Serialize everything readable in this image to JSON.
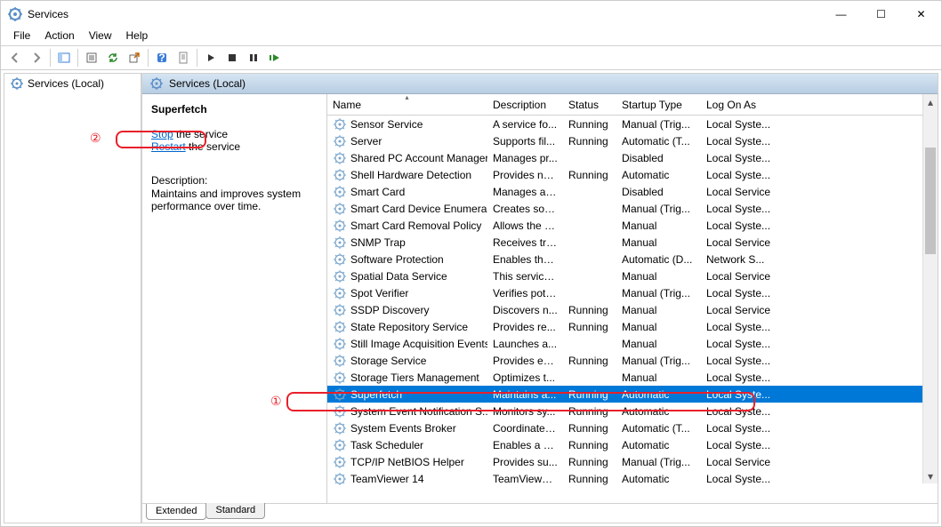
{
  "window": {
    "title": "Services",
    "min_glyph": "—",
    "max_glyph": "☐",
    "close_glyph": "✕"
  },
  "menu": {
    "file": "File",
    "action": "Action",
    "view": "View",
    "help": "Help"
  },
  "tree": {
    "root": "Services (Local)"
  },
  "right_header": "Services (Local)",
  "detail": {
    "name": "Superfetch",
    "stop_link": "Stop",
    "stop_rest": " the service",
    "restart_link": "Restart",
    "restart_rest": " the service",
    "desc_label": "Description:",
    "desc_text": "Maintains and improves system performance over time."
  },
  "columns": {
    "name": "Name",
    "desc": "Description",
    "status": "Status",
    "startup": "Startup Type",
    "logon": "Log On As"
  },
  "tabs": {
    "extended": "Extended",
    "standard": "Standard"
  },
  "annot": {
    "one": "①",
    "two": "②"
  },
  "rows": [
    {
      "name": "Sensor Service",
      "desc": "A service fo...",
      "status": "Running",
      "startup": "Manual (Trig...",
      "logon": "Local Syste..."
    },
    {
      "name": "Server",
      "desc": "Supports fil...",
      "status": "Running",
      "startup": "Automatic (T...",
      "logon": "Local Syste..."
    },
    {
      "name": "Shared PC Account Manager",
      "desc": "Manages pr...",
      "status": "",
      "startup": "Disabled",
      "logon": "Local Syste..."
    },
    {
      "name": "Shell Hardware Detection",
      "desc": "Provides no...",
      "status": "Running",
      "startup": "Automatic",
      "logon": "Local Syste..."
    },
    {
      "name": "Smart Card",
      "desc": "Manages ac...",
      "status": "",
      "startup": "Disabled",
      "logon": "Local Service"
    },
    {
      "name": "Smart Card Device Enumera...",
      "desc": "Creates soft...",
      "status": "",
      "startup": "Manual (Trig...",
      "logon": "Local Syste..."
    },
    {
      "name": "Smart Card Removal Policy",
      "desc": "Allows the s...",
      "status": "",
      "startup": "Manual",
      "logon": "Local Syste..."
    },
    {
      "name": "SNMP Trap",
      "desc": "Receives tra...",
      "status": "",
      "startup": "Manual",
      "logon": "Local Service"
    },
    {
      "name": "Software Protection",
      "desc": "Enables the ...",
      "status": "",
      "startup": "Automatic (D...",
      "logon": "Network S..."
    },
    {
      "name": "Spatial Data Service",
      "desc": "This service ...",
      "status": "",
      "startup": "Manual",
      "logon": "Local Service"
    },
    {
      "name": "Spot Verifier",
      "desc": "Verifies pote...",
      "status": "",
      "startup": "Manual (Trig...",
      "logon": "Local Syste..."
    },
    {
      "name": "SSDP Discovery",
      "desc": "Discovers n...",
      "status": "Running",
      "startup": "Manual",
      "logon": "Local Service"
    },
    {
      "name": "State Repository Service",
      "desc": "Provides re...",
      "status": "Running",
      "startup": "Manual",
      "logon": "Local Syste..."
    },
    {
      "name": "Still Image Acquisition Events",
      "desc": "Launches a...",
      "status": "",
      "startup": "Manual",
      "logon": "Local Syste..."
    },
    {
      "name": "Storage Service",
      "desc": "Provides en...",
      "status": "Running",
      "startup": "Manual (Trig...",
      "logon": "Local Syste..."
    },
    {
      "name": "Storage Tiers Management",
      "desc": "Optimizes t...",
      "status": "",
      "startup": "Manual",
      "logon": "Local Syste..."
    },
    {
      "name": "Superfetch",
      "desc": "Maintains a...",
      "status": "Running",
      "startup": "Automatic",
      "logon": "Local Syste...",
      "selected": true
    },
    {
      "name": "System Event Notification S...",
      "desc": "Monitors sy...",
      "status": "Running",
      "startup": "Automatic",
      "logon": "Local Syste..."
    },
    {
      "name": "System Events Broker",
      "desc": "Coordinates...",
      "status": "Running",
      "startup": "Automatic (T...",
      "logon": "Local Syste..."
    },
    {
      "name": "Task Scheduler",
      "desc": "Enables a us...",
      "status": "Running",
      "startup": "Automatic",
      "logon": "Local Syste..."
    },
    {
      "name": "TCP/IP NetBIOS Helper",
      "desc": "Provides su...",
      "status": "Running",
      "startup": "Manual (Trig...",
      "logon": "Local Service"
    },
    {
      "name": "TeamViewer 14",
      "desc": "TeamViewer...",
      "status": "Running",
      "startup": "Automatic",
      "logon": "Local Syste..."
    }
  ]
}
